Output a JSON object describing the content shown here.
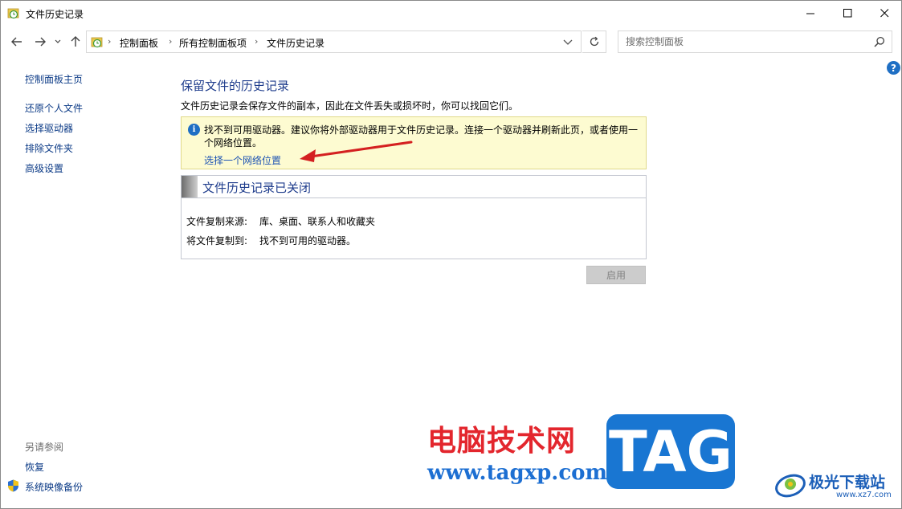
{
  "window": {
    "title": "文件历史记录"
  },
  "address_bar": {
    "crumbs": [
      "控制面板",
      "所有控制面板项",
      "文件历史记录"
    ]
  },
  "search": {
    "placeholder": "搜索控制面板"
  },
  "sidebar": {
    "home": "控制面板主页",
    "items": [
      "还原个人文件",
      "选择驱动器",
      "排除文件夹",
      "高级设置"
    ],
    "see_also_label": "另请参阅",
    "see_also": [
      "恢复",
      "系统映像备份"
    ]
  },
  "main": {
    "title": "保留文件的历史记录",
    "description": "文件历史记录会保存文件的副本，因此在文件丢失或损坏时，你可以找回它们。",
    "info": {
      "text": "找不到可用驱动器。建议你将外部驱动器用于文件历史记录。连接一个驱动器并刷新此页，或者使用一个网络位置。",
      "link": "选择一个网络位置"
    },
    "status": {
      "title": "文件历史记录已关闭",
      "copy_from_label": "文件复制来源:",
      "copy_from_value": "库、桌面、联系人和收藏夹",
      "copy_to_label": "将文件复制到:",
      "copy_to_value": "找不到可用的驱动器。"
    },
    "enable_button": "启用"
  },
  "watermark": {
    "cn_text": "电脑技术网",
    "url": "www.tagxp.com",
    "tag": "TAG",
    "site": "极光下载站",
    "site_url": "www.xz7.com"
  },
  "colors": {
    "link": "#0b3a86",
    "heading": "#1e3c8c",
    "info_bg": "#fdfbd1",
    "arrow": "#d42020",
    "accent": "#1f6fc4"
  }
}
